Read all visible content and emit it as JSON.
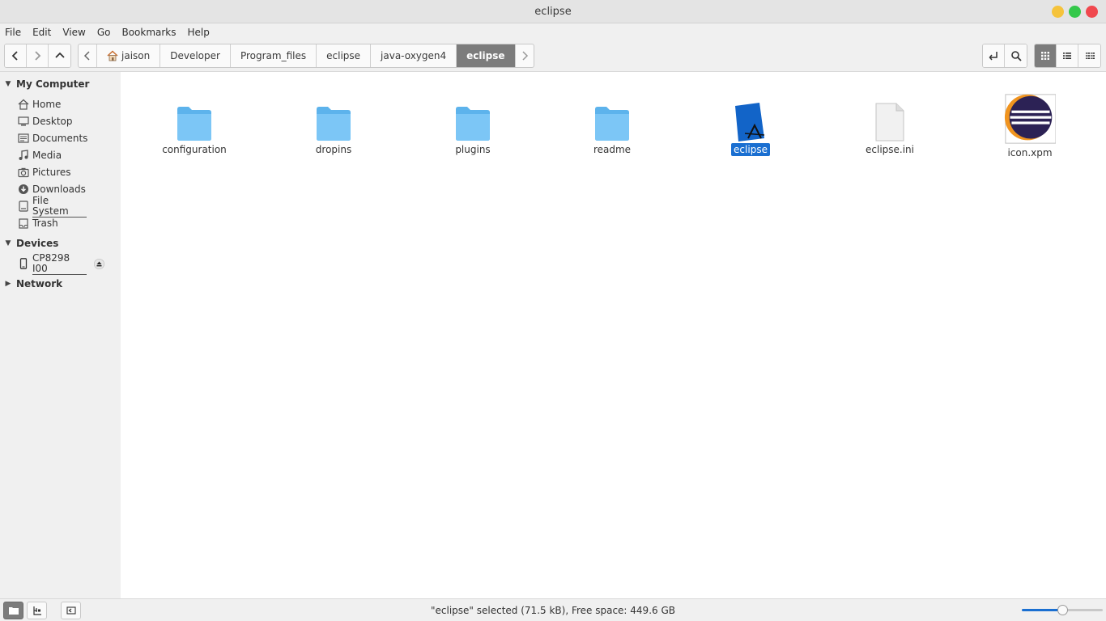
{
  "window": {
    "title": "eclipse",
    "colors": {
      "minimize": "#f5c33b",
      "maximize": "#34c84a",
      "close": "#f0484e"
    }
  },
  "menu": [
    "File",
    "Edit",
    "View",
    "Go",
    "Bookmarks",
    "Help"
  ],
  "breadcrumbs": {
    "items": [
      "jaison",
      "Developer",
      "Program_files",
      "eclipse",
      "java-oxygen4",
      "eclipse"
    ],
    "active_index": 5
  },
  "sidebar": {
    "my_computer": {
      "label": "My Computer",
      "items": [
        "Home",
        "Desktop",
        "Documents",
        "Media",
        "Pictures",
        "Downloads",
        "File System",
        "Trash"
      ]
    },
    "devices": {
      "label": "Devices",
      "items": [
        "CP8298 I00"
      ]
    },
    "network": {
      "label": "Network"
    }
  },
  "files": [
    {
      "name": "configuration",
      "kind": "folder"
    },
    {
      "name": "dropins",
      "kind": "folder"
    },
    {
      "name": "plugins",
      "kind": "folder"
    },
    {
      "name": "readme",
      "kind": "folder"
    },
    {
      "name": "eclipse",
      "kind": "executable",
      "selected": true
    },
    {
      "name": "eclipse.ini",
      "kind": "text-file"
    },
    {
      "name": "icon.xpm",
      "kind": "eclipse-logo-image"
    }
  ],
  "status": {
    "text": "\"eclipse\" selected (71.5 kB), Free space: 449.6 GB",
    "zoom_fraction": 0.5
  },
  "accent_color": "#1a6fd1"
}
